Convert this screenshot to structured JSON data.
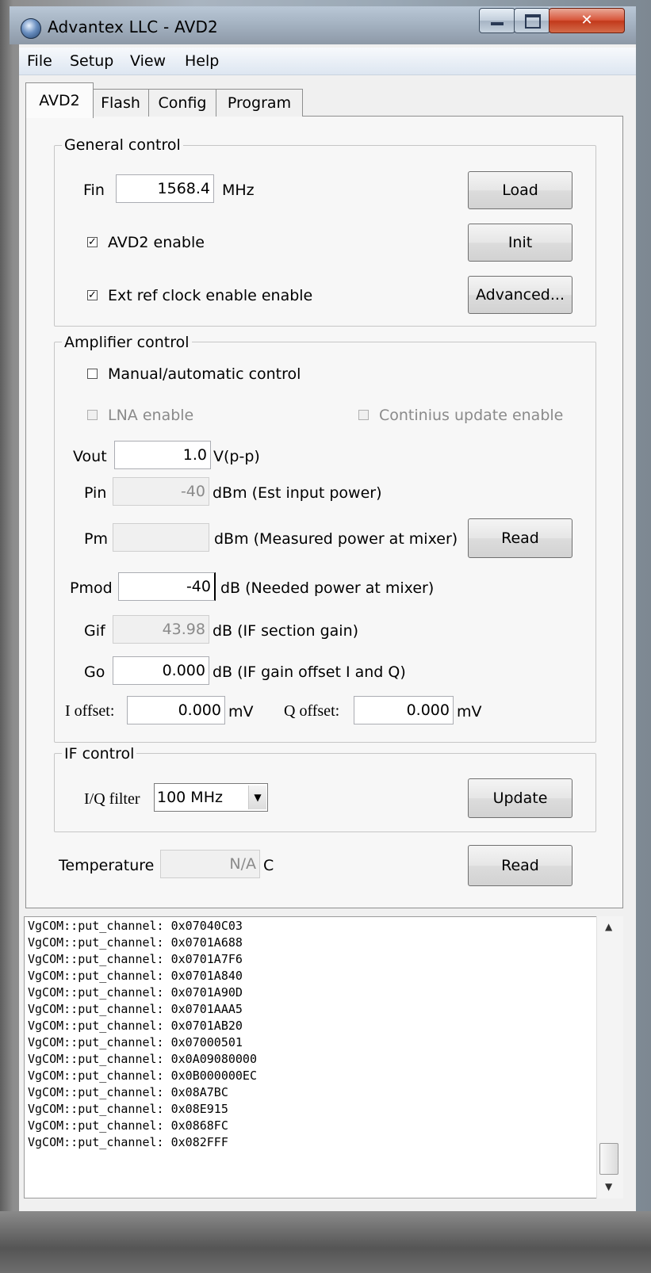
{
  "window": {
    "title": "Advantex LLC - AVD2"
  },
  "menu": [
    "File",
    "Setup",
    "View",
    "Help"
  ],
  "tabs": [
    "AVD2",
    "Flash",
    "Config",
    "Program"
  ],
  "general": {
    "title": "General control",
    "fin_label": "Fin",
    "fin_value": "1568.4",
    "fin_unit": "MHz",
    "avd2_enable_label": "AVD2 enable",
    "avd2_enable_checked": true,
    "ext_ref_label": "Ext ref clock enable enable",
    "ext_ref_checked": true,
    "load_label": "Load",
    "init_label": "Init",
    "advanced_label": "Advanced..."
  },
  "amp": {
    "title": "Amplifier control",
    "manual_label": "Manual/automatic control",
    "manual_checked": false,
    "lna_label": "LNA enable",
    "continuous_label": "Continius update enable",
    "vout_label": "Vout",
    "vout_value": "1.0",
    "vout_unit": "V(p-p)",
    "pin_label": "Pin",
    "pin_value": "-40",
    "pin_unit": "dBm (Est input power)",
    "pm_label": "Pm",
    "pm_value": "",
    "pm_unit": "dBm (Measured power at mixer)",
    "read_label": "Read",
    "pmod_label": "Pmod",
    "pmod_value": "-40",
    "pmod_unit": "dB (Needed power at mixer)",
    "gif_label": "Gif",
    "gif_value": "43.98",
    "gif_unit": "dB (IF section gain)",
    "go_label": "Go",
    "go_value": "0.000",
    "go_unit": "dB  (IF gain offset I and Q)",
    "ioff_label": "I offset:",
    "ioff_value": "0.000",
    "ioff_unit": "mV",
    "qoff_label": "Q offset:",
    "qoff_value": "0.000",
    "qoff_unit": "mV"
  },
  "if": {
    "title": "IF control",
    "filter_label": "I/Q filter",
    "filter_value": "100 MHz",
    "update_label": "Update"
  },
  "temp": {
    "label": "Temperature",
    "value": "N/A",
    "unit": "C",
    "read_label": "Read"
  },
  "log": [
    "VgCOM::put_channel: 0x07040C03",
    "VgCOM::put_channel: 0x0701A688",
    "VgCOM::put_channel: 0x0701A7F6",
    "VgCOM::put_channel: 0x0701A840",
    "VgCOM::put_channel: 0x0701A90D",
    "VgCOM::put_channel: 0x0701AAA5",
    "VgCOM::put_channel: 0x0701AB20",
    "VgCOM::put_channel: 0x07000501",
    "VgCOM::put_channel: 0x0A09080000",
    "VgCOM::put_channel: 0x0B000000EC",
    "VgCOM::put_channel: 0x08A7BC",
    "VgCOM::put_channel: 0x08E915",
    "VgCOM::put_channel: 0x0868FC",
    "VgCOM::put_channel: 0x082FFF"
  ]
}
